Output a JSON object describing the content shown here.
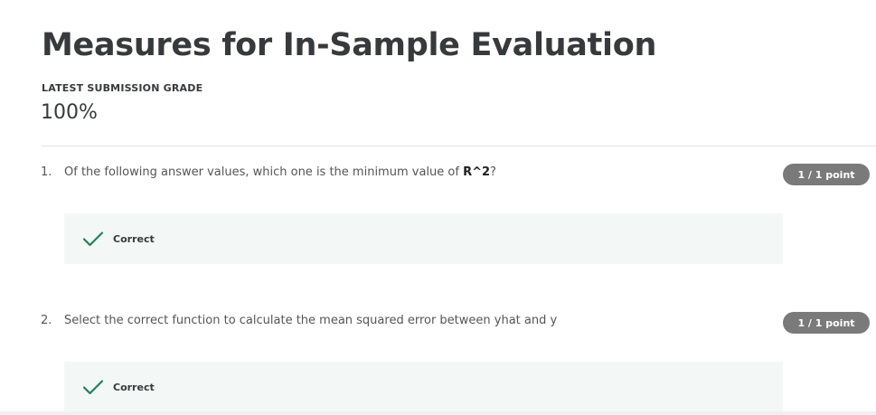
{
  "header": {
    "title": "Measures for In-Sample Evaluation",
    "grade_label": "LATEST SUBMISSION GRADE",
    "grade_value": "100%"
  },
  "questions": [
    {
      "number": "1.",
      "text_before": "Of the following answer values, which one is the minimum value of ",
      "text_bold": "R^2",
      "text_after": "?",
      "points": "1 / 1 point",
      "feedback": "Correct"
    },
    {
      "number": "2.",
      "text_before": "Select the correct function to calculate the mean squared error between yhat and y",
      "text_bold": "",
      "text_after": "",
      "points": "1 / 1 point",
      "feedback": "Correct"
    }
  ],
  "colors": {
    "success": "#1f8354",
    "badge": "#7a7a7a",
    "feedback_bg": "#f3f8f6"
  },
  "icons": {
    "feedback_icon": "check-icon"
  }
}
